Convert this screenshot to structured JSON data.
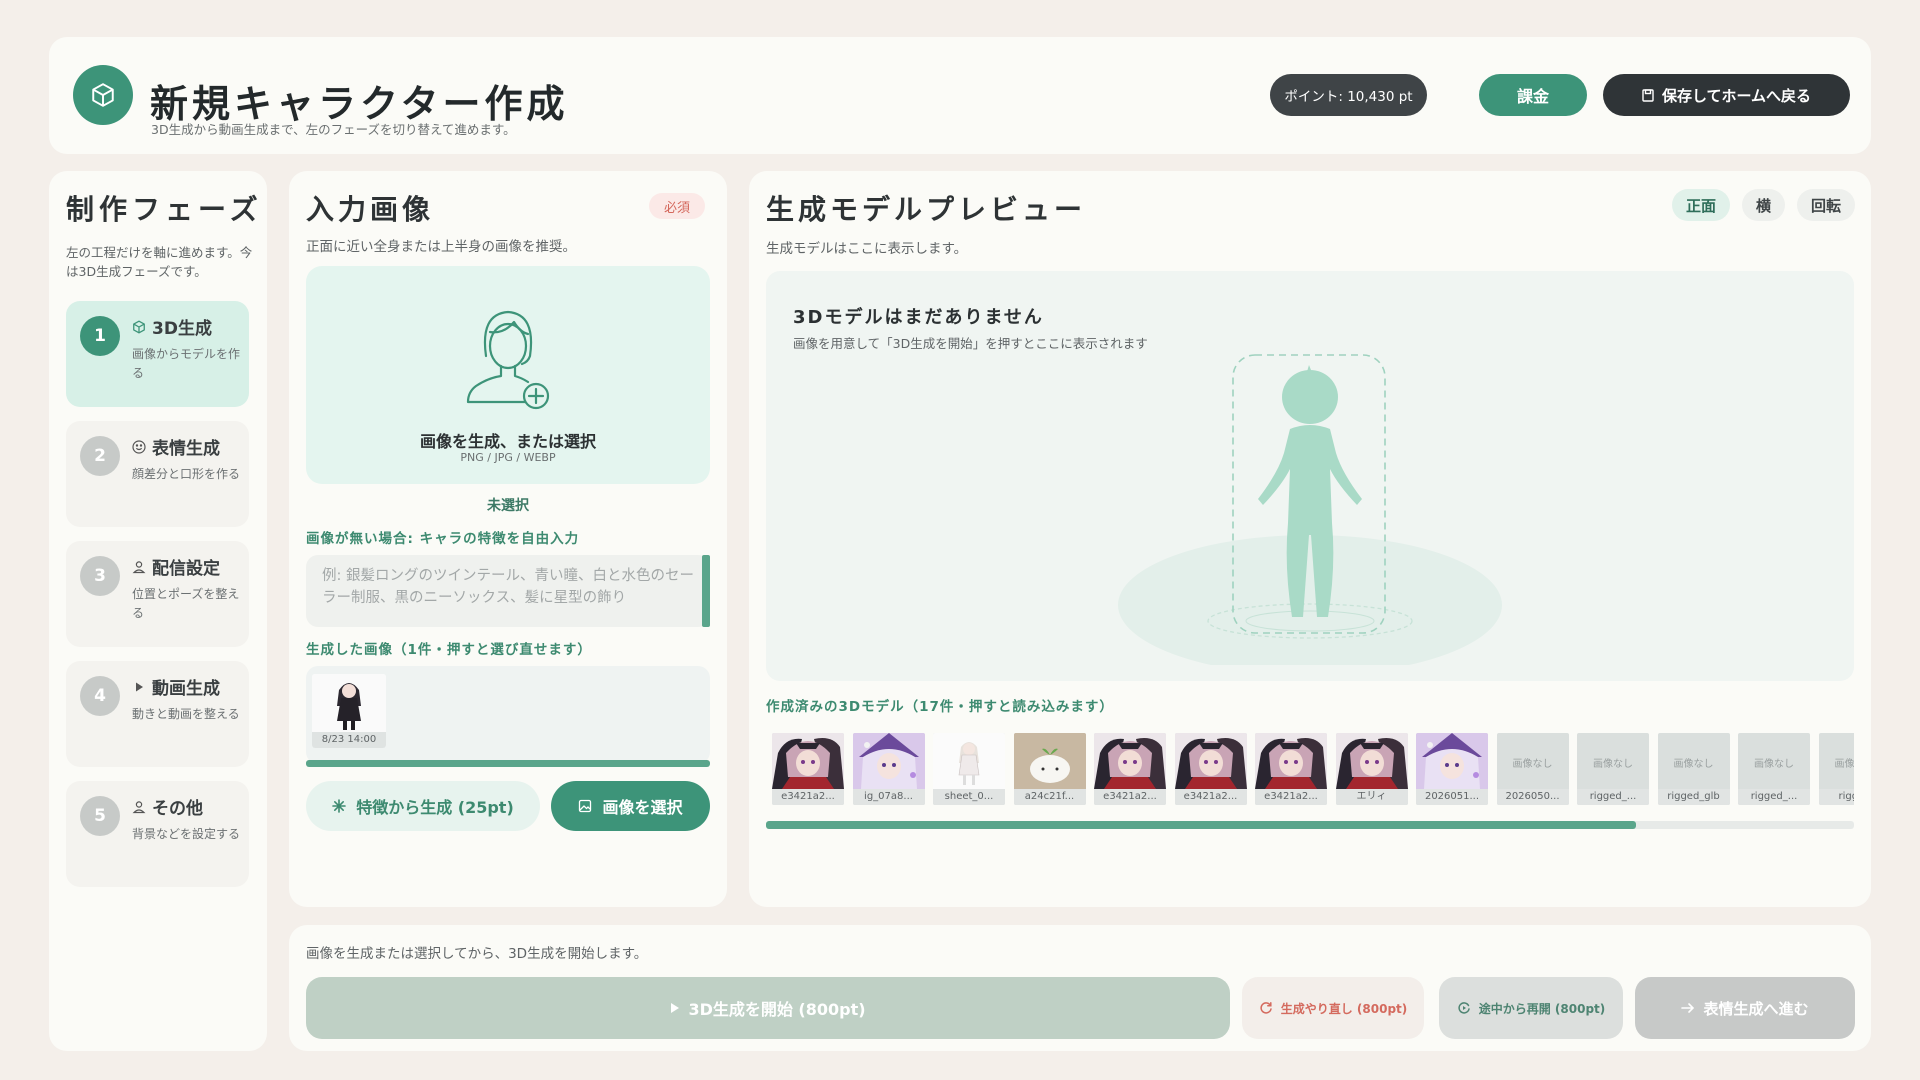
{
  "header": {
    "title": "新規キャラクター作成",
    "subtitle": "3D生成から動画生成まで、左のフェーズを切り替えて進めます。",
    "points": "ポイント: 10,430 pt",
    "charge_label": "課金",
    "save_home_label": "保存してホームへ戻る",
    "logo_icon": "cube-icon"
  },
  "sidebar": {
    "title": "制作フェーズ",
    "description": "左の工程だけを軸に進めます。今は3D生成フェーズです。",
    "phases": [
      {
        "num": "1",
        "name": "3D生成",
        "desc": "画像からモデルを作る",
        "icon": "cube-icon",
        "active": true
      },
      {
        "num": "2",
        "name": "表情生成",
        "desc": "顔差分と口形を作る",
        "icon": "smile-icon",
        "active": false
      },
      {
        "num": "3",
        "name": "配信設定",
        "desc": "位置とポーズを整える",
        "icon": "person-icon",
        "active": false
      },
      {
        "num": "4",
        "name": "動画生成",
        "desc": "動きと動画を整える",
        "icon": "play-icon",
        "active": false
      },
      {
        "num": "5",
        "name": "その他",
        "desc": "背景などを設定する",
        "icon": "person-icon",
        "active": false
      }
    ]
  },
  "input_panel": {
    "title": "入力画像",
    "required_badge": "必須",
    "description": "正面に近い全身または上半身の画像を推奨。",
    "drop_label": "画像を生成、または選択",
    "drop_formats": "PNG / JPG / WEBP",
    "selection_status": "未選択",
    "feature_label": "画像が無い場合: キャラの特徴を自由入力",
    "feature_placeholder": "例: 銀髪ロングのツインテール、青い瞳、白と水色のセーラー制服、黒のニーソックス、髪に星型の飾り",
    "generated_label": "生成した画像（1件・押すと選び直せます）",
    "generated_images": [
      {
        "caption": "8/23 14:00"
      }
    ],
    "generate_from_features_label": "特徴から生成 (25pt)",
    "select_image_label": "画像を選択"
  },
  "preview_panel": {
    "title": "生成モデルプレビュー",
    "description": "生成モデルはここに表示します。",
    "view_tabs": [
      {
        "label": "正面",
        "active": true
      },
      {
        "label": "横",
        "active": false
      },
      {
        "label": "回転",
        "active": false
      }
    ],
    "empty_title": "3Dモデルはまだありません",
    "empty_desc": "画像を用意して「3D生成を開始」を押すとここに表示されます",
    "models_label": "作成済みの3Dモデル（17件・押すと読み込みます）",
    "models": [
      {
        "caption": "e3421a2...",
        "kind": "dark"
      },
      {
        "caption": "ig_07a8...",
        "kind": "purple"
      },
      {
        "caption": "sheet_0...",
        "kind": "sheet"
      },
      {
        "caption": "a24c21f...",
        "kind": "blob"
      },
      {
        "caption": "e3421a2...",
        "kind": "dark"
      },
      {
        "caption": "e3421a2...",
        "kind": "dark"
      },
      {
        "caption": "e3421a2...",
        "kind": "dark"
      },
      {
        "caption": "エリィ",
        "kind": "dark"
      },
      {
        "caption": "2026051...",
        "kind": "purple"
      },
      {
        "caption": "2026050...",
        "kind": "none"
      },
      {
        "caption": "rigged_...",
        "kind": "none"
      },
      {
        "caption": "rigged_glb",
        "kind": "none"
      },
      {
        "caption": "rigged_...",
        "kind": "none"
      },
      {
        "caption": "rigged",
        "kind": "none"
      }
    ],
    "no_image_label": "画像なし",
    "models_scroll_fraction": 0.8
  },
  "footer": {
    "message": "画像を生成または選択してから、3D生成を開始します。",
    "start_label": "3D生成を開始 (800pt)",
    "regenerate_label": "生成やり直し (800pt)",
    "resume_label": "途中から再開 (800pt)",
    "next_label": "表情生成へ進む"
  },
  "colors": {
    "accent": "#3d9479",
    "dark": "#2f3437",
    "background": "#f4efea",
    "danger": "#d46a5e"
  }
}
